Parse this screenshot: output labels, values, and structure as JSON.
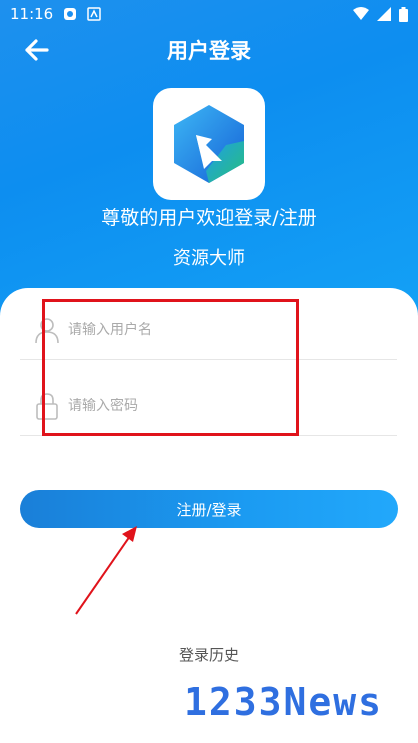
{
  "status_bar": {
    "time": "11:16"
  },
  "header": {
    "title": "用户登录",
    "back_icon": "arrow-left-icon"
  },
  "brand": {
    "logo_icon": "app-logo-icon",
    "welcome": "尊敬的用户欢迎登录/注册",
    "app_name": "资源大师"
  },
  "form": {
    "username": {
      "placeholder": "请输入用户名",
      "value": "",
      "icon": "user-icon"
    },
    "password": {
      "placeholder": "请输入密码",
      "value": "",
      "icon": "lock-icon"
    },
    "submit_label": "注册/登录"
  },
  "footer": {
    "history_label": "登录历史"
  },
  "watermark": {
    "text": "1233News"
  },
  "colors": {
    "primary": "#1b8ff0",
    "highlight": "#e0131b",
    "watermark": "#2f6fe0"
  }
}
